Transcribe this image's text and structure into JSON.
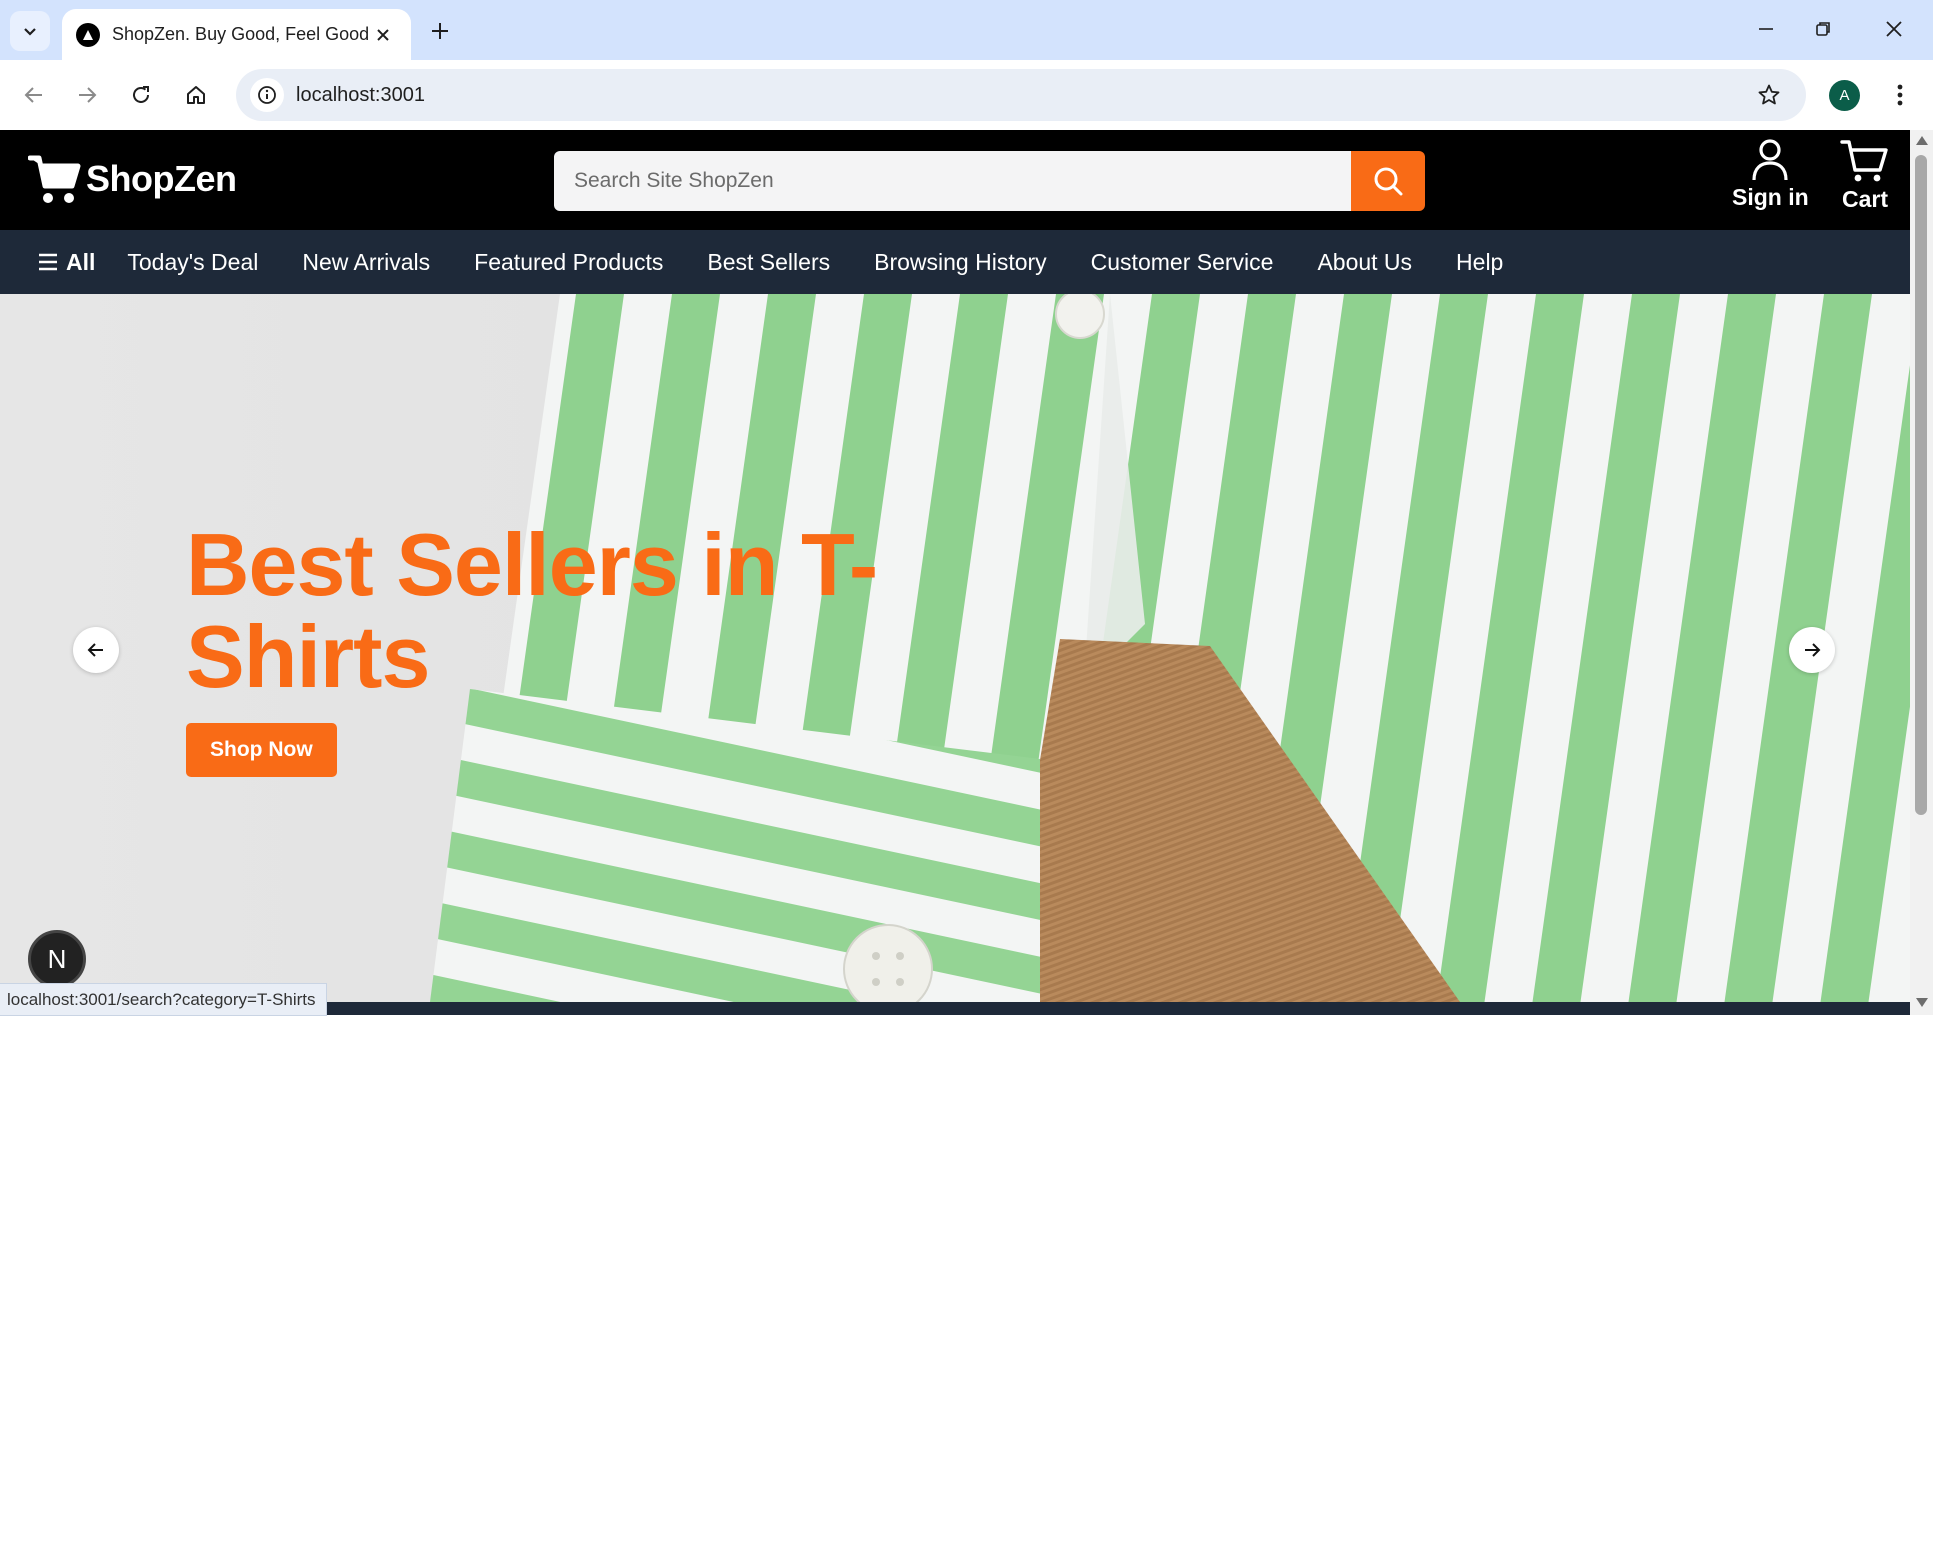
{
  "browser": {
    "tab_title": "ShopZen. Buy Good, Feel Good.",
    "url": "localhost:3001",
    "profile_initial": "A",
    "status_url": "localhost:3001/search?category=T-Shirts"
  },
  "header": {
    "logo_text": "ShopZen",
    "search_placeholder": "Search Site ShopZen",
    "sign_in_label": "Sign in",
    "cart_label": "Cart"
  },
  "nav": {
    "all_label": "All",
    "links": [
      "Today's Deal",
      "New Arrivals",
      "Featured Products",
      "Best Sellers",
      "Browsing History",
      "Customer Service",
      "About Us",
      "Help"
    ]
  },
  "hero": {
    "title": "Best Sellers in T-Shirts",
    "button_label": "Shop Now"
  },
  "dev_badge": "N",
  "colors": {
    "accent": "#f96b16",
    "header_bg": "#000000",
    "nav_bg": "#1e2939",
    "stripe_green": "#8fd18f"
  }
}
